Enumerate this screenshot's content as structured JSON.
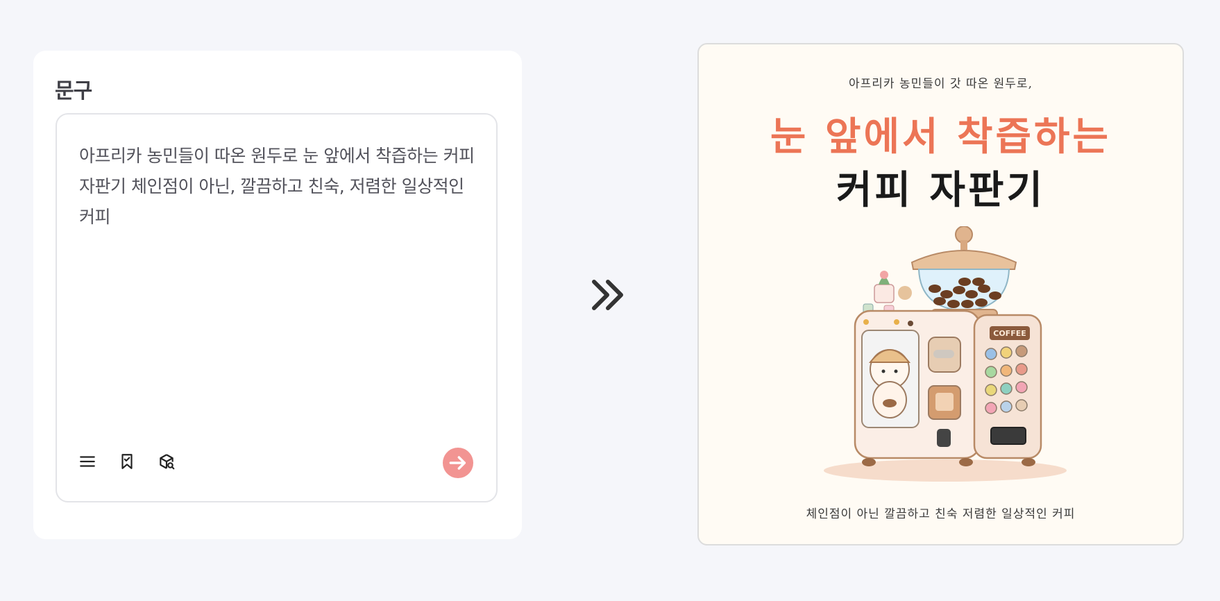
{
  "input_card": {
    "title": "문구",
    "prompt_text": "아프리카 농민들이 따온 원두로 눈 앞에서 착즙하는 커피 자판기 체인점이 아닌, 깔끔하고 친숙, 저렴한 일상적인 커피",
    "toolbar": {
      "menu_icon": "menu-icon",
      "bookmark_icon": "bookmark-icon",
      "search_box_icon": "box-search-icon",
      "submit_icon": "arrow-right-icon"
    },
    "accent_color": "#f29492"
  },
  "separator_icon": "double-chevron-right-icon",
  "poster": {
    "top_caption": "아프리카 농민들이 갓 따온 원두로,",
    "headline_line1": "눈 앞에서 착즙하는",
    "headline_line2": "커피 자판기",
    "machine_label": "COFFEE",
    "bottom_caption": "체인점이 아닌 깔끔하고 친숙 저렴한 일상적인 커피",
    "headline_color": "#ec7556"
  }
}
